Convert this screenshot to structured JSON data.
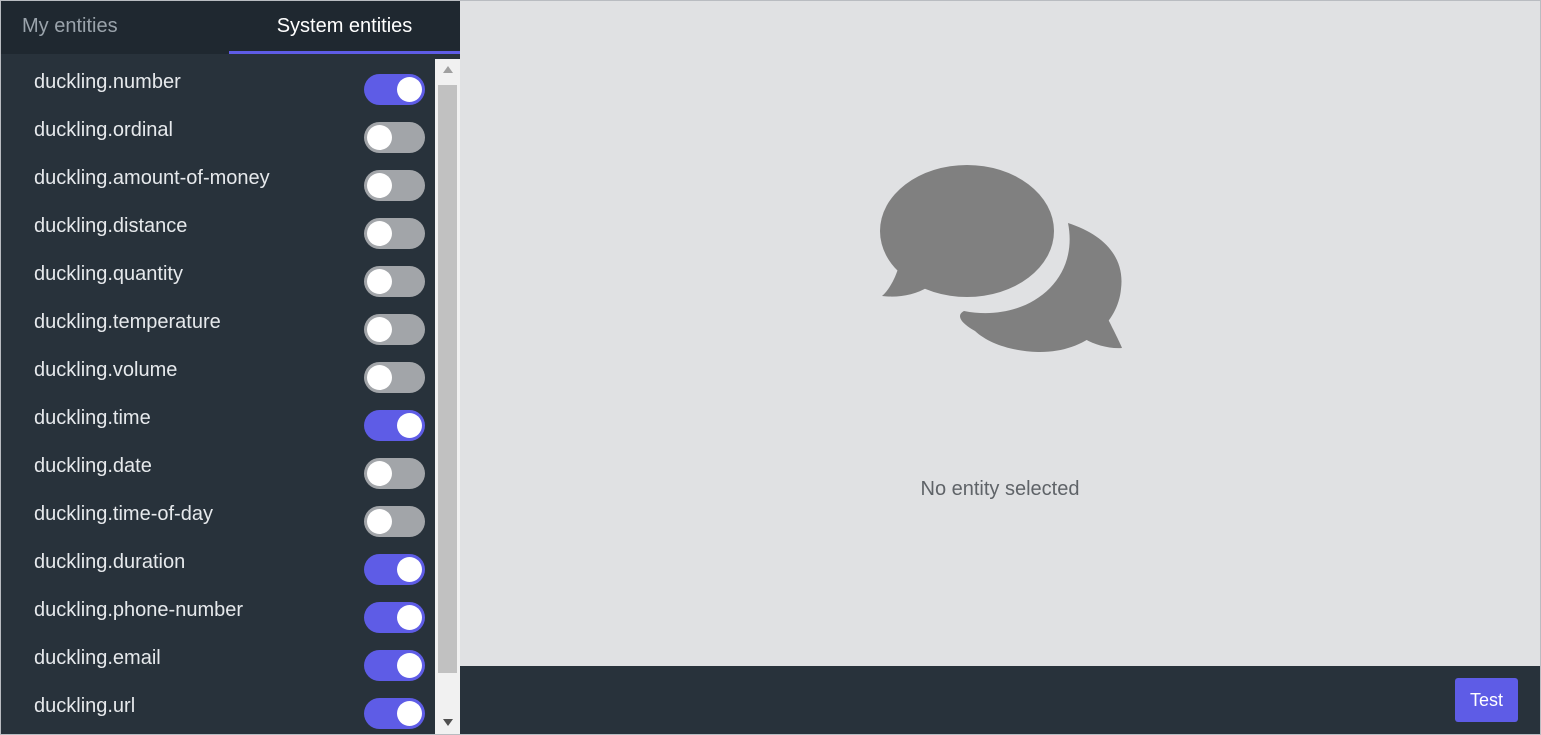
{
  "tabs": {
    "my_entities": "My entities",
    "system_entities": "System entities"
  },
  "entities": [
    {
      "name": "duckling.number",
      "enabled": true
    },
    {
      "name": "duckling.ordinal",
      "enabled": false
    },
    {
      "name": "duckling.amount-of-money",
      "enabled": false
    },
    {
      "name": "duckling.distance",
      "enabled": false
    },
    {
      "name": "duckling.quantity",
      "enabled": false
    },
    {
      "name": "duckling.temperature",
      "enabled": false
    },
    {
      "name": "duckling.volume",
      "enabled": false
    },
    {
      "name": "duckling.time",
      "enabled": true
    },
    {
      "name": "duckling.date",
      "enabled": false
    },
    {
      "name": "duckling.time-of-day",
      "enabled": false
    },
    {
      "name": "duckling.duration",
      "enabled": true
    },
    {
      "name": "duckling.phone-number",
      "enabled": true
    },
    {
      "name": "duckling.email",
      "enabled": true
    },
    {
      "name": "duckling.url",
      "enabled": true
    }
  ],
  "main": {
    "empty_icon": "chat-bubbles-icon",
    "empty_message": "No entity selected"
  },
  "footer": {
    "test_label": "Test"
  },
  "colors": {
    "accent": "#5e5ce6",
    "sidebar_bg": "#28323b",
    "main_bg": "#e0e1e3",
    "toggle_off": "#a2a5a9",
    "icon_gray": "#808080"
  }
}
